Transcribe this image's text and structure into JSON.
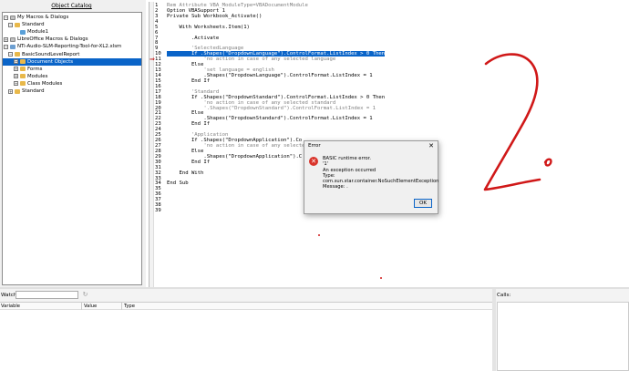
{
  "catalog": {
    "title": "Object Catalog",
    "items": [
      {
        "label": "My Macros & Dialogs",
        "expander": "−",
        "icon": "lib"
      },
      {
        "label": "Standard",
        "expander": "−",
        "icon": "folder"
      },
      {
        "label": "Module1",
        "expander": "",
        "icon": "mod"
      },
      {
        "label": "LibreOffice Macros & Dialogs",
        "expander": "+",
        "icon": "lib"
      },
      {
        "label": "NTi-Audio-SLM-Reporting-Tool-for-XL2.xlsm",
        "expander": "−",
        "icon": "doc"
      },
      {
        "label": "BasicSoundLevelReport",
        "expander": "−",
        "icon": "folder"
      },
      {
        "label": "Document Objects",
        "expander": "+",
        "icon": "folder"
      },
      {
        "label": "Forms",
        "expander": "+",
        "icon": "folder"
      },
      {
        "label": "Modules",
        "expander": "+",
        "icon": "folder"
      },
      {
        "label": "Class Modules",
        "expander": "+",
        "icon": "folder"
      },
      {
        "label": "Standard",
        "expander": "+",
        "icon": "folder"
      }
    ]
  },
  "editor": {
    "line_numbers": [
      "1",
      "2",
      "3",
      "4",
      "5",
      "6",
      "7",
      "8",
      "9",
      "10",
      "11",
      "12",
      "13",
      "14",
      "15",
      "16",
      "17",
      "18",
      "19",
      "20",
      "21",
      "22",
      "23",
      "24",
      "25",
      "26",
      "27",
      "28",
      "29",
      "30",
      "31",
      "32",
      "33",
      "34",
      "35",
      "36",
      "37",
      "38",
      "39"
    ],
    "lines": [
      "Rem Attribute VBA_ModuleType=VBADocumentModule",
      "Option VBASupport 1",
      "Private Sub Workbook_Activate()",
      "",
      "    With Worksheets.Item(1)",
      "",
      "        .Activate",
      "",
      "        'SelectedLanguage",
      "        If .Shapes(\"DropdownLanguage\").ControlFormat.ListIndex > 0 Then",
      "            'no action in case of any selected language",
      "        Else",
      "            'set language = english",
      "            .Shapes(\"DropdownLanguage\").ControlFormat.ListIndex = 1",
      "        End If",
      "",
      "        'Standard",
      "        If .Shapes(\"DropdownStandard\").ControlFormat.ListIndex > 0 Then",
      "            'no action in case of any selected standard",
      "            '.Shapes(\"DropdownStandard\").ControlFormat.ListIndex = 1",
      "        Else",
      "            .Shapes(\"DropdownStandard\").ControlFormat.ListIndex = 1",
      "        End If",
      "",
      "        'Application",
      "        If .Shapes(\"DropdownApplication\").Co",
      "            'no action in case of any selecte",
      "        Else",
      "            .Shapes(\"DropdownApplication\").C",
      "        End If",
      "",
      "    End With",
      "",
      "End Sub",
      "",
      "",
      "",
      "",
      ""
    ],
    "current_line": "10",
    "breakpoint_glyph": "⇒"
  },
  "dialog": {
    "title": "Error",
    "close_glyph": "✕",
    "error_glyph": "✕",
    "message_lines": [
      "BASIC runtime error.",
      "'1'",
      "An exception occurred",
      "Type: com.sun.star.container.NoSuchElementException",
      "Message: ."
    ],
    "ok_label": "OK"
  },
  "watch": {
    "label": "Watch:",
    "input_value": "",
    "remove_glyph": "↻",
    "columns": [
      "Variable",
      "Value",
      "Type"
    ]
  },
  "calls": {
    "label": "Calls:"
  },
  "annotation_colors": {
    "ink": "#d01818"
  }
}
